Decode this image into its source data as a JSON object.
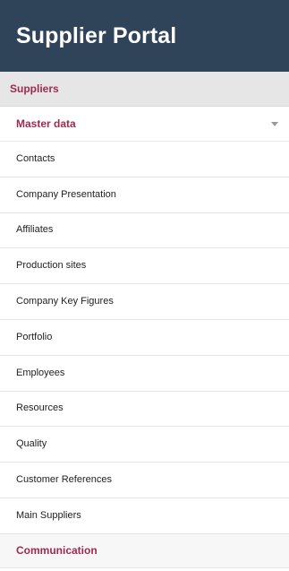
{
  "header": {
    "title": "Supplier Portal"
  },
  "navigation": {
    "section_label": "Suppliers",
    "group_label": "Master data",
    "group_icon": "chevron-down-icon",
    "items": [
      {
        "label": "Contacts"
      },
      {
        "label": "Company Presentation"
      },
      {
        "label": "Affiliates"
      },
      {
        "label": "Production sites"
      },
      {
        "label": "Company Key Figures"
      },
      {
        "label": "Portfolio"
      },
      {
        "label": "Employees"
      },
      {
        "label": "Resources"
      },
      {
        "label": "Quality"
      },
      {
        "label": "Customer References"
      },
      {
        "label": "Main Suppliers"
      }
    ],
    "footer_label": "Communication"
  },
  "colors": {
    "header_bg": "#2f4359",
    "accent": "#9c2c4f",
    "section_bg": "#e6e6e6"
  }
}
